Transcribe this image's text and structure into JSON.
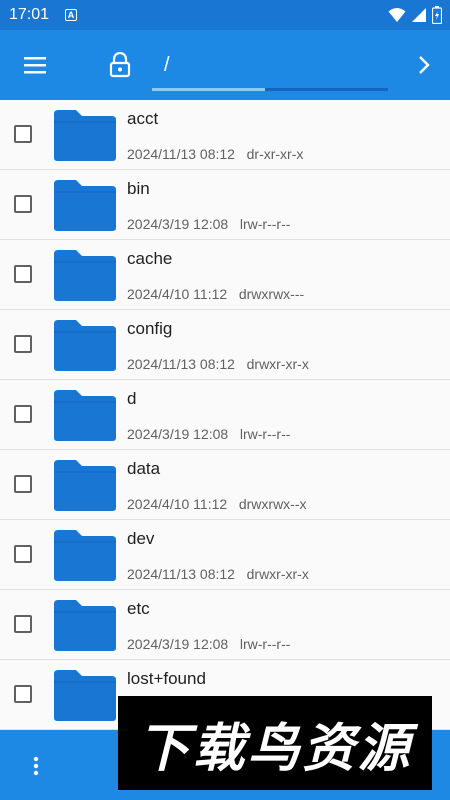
{
  "status": {
    "time": "17:01",
    "notif_letter": "A"
  },
  "toolbar": {
    "path": "/",
    "progress_fraction": 0.48
  },
  "files": [
    {
      "name": "acct",
      "date": "2024/11/13 08:12",
      "perm": "dr-xr-xr-x"
    },
    {
      "name": "bin",
      "date": "2024/3/19 12:08",
      "perm": "lrw-r--r--"
    },
    {
      "name": "cache",
      "date": "2024/4/10 11:12",
      "perm": "drwxrwx---"
    },
    {
      "name": "config",
      "date": "2024/11/13 08:12",
      "perm": "drwxr-xr-x"
    },
    {
      "name": "d",
      "date": "2024/3/19 12:08",
      "perm": "lrw-r--r--"
    },
    {
      "name": "data",
      "date": "2024/4/10 11:12",
      "perm": "drwxrwx--x"
    },
    {
      "name": "dev",
      "date": "2024/11/13 08:12",
      "perm": "drwxr-xr-x"
    },
    {
      "name": "etc",
      "date": "2024/3/19 12:08",
      "perm": "lrw-r--r--"
    },
    {
      "name": "lost+found",
      "date": "",
      "perm": ""
    }
  ],
  "watermark": {
    "text": "下载鸟资源"
  },
  "colors": {
    "primary": "#1e88e5",
    "folder": "#1976d2"
  }
}
